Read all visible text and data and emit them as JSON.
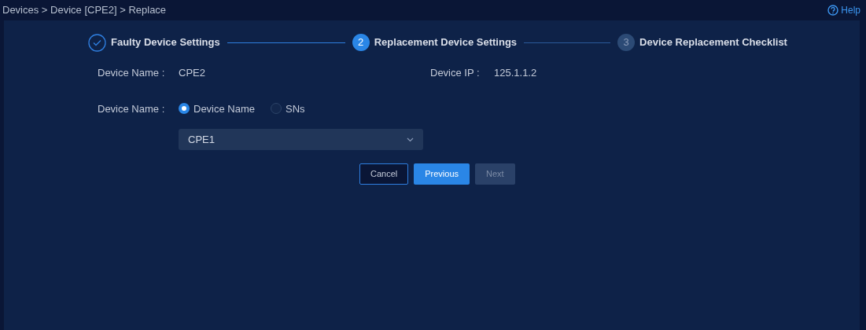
{
  "breadcrumb": "Devices > Device [CPE2] > Replace",
  "help": {
    "label": "Help"
  },
  "steps": [
    {
      "kind": "done",
      "label": "Faulty Device Settings"
    },
    {
      "kind": "active",
      "number": "2",
      "label": "Replacement Device Settings"
    },
    {
      "kind": "pending",
      "number": "3",
      "label": "Device Replacement Checklist"
    }
  ],
  "faulty_device": {
    "name_label": "Device Name :",
    "name_value": "CPE2",
    "ip_label": "Device IP :",
    "ip_value": "125.1.1.2"
  },
  "replacement": {
    "label": "Device Name :",
    "options": [
      {
        "label": "Device Name",
        "selected": true
      },
      {
        "label": "SNs",
        "selected": false
      }
    ],
    "select_value": "CPE1"
  },
  "buttons": [
    {
      "kind": "outline",
      "label": "Cancel",
      "disabled": false
    },
    {
      "kind": "primary",
      "label": "Previous",
      "disabled": false
    },
    {
      "kind": "primary",
      "label": "Next",
      "disabled": true
    }
  ]
}
